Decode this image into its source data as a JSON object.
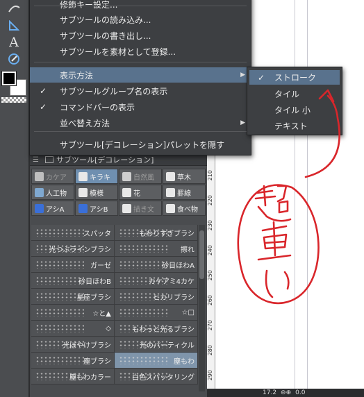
{
  "main_menu": {
    "items": [
      {
        "label": "修飾キー設定...",
        "checked": false,
        "submenu": false
      },
      {
        "label": "サブツールの読み込み...",
        "checked": false,
        "submenu": false
      },
      {
        "label": "サブツールの書き出し...",
        "checked": false,
        "submenu": false
      },
      {
        "label": "サブツールを素材として登録...",
        "checked": false,
        "submenu": false
      },
      {
        "label": "表示方法",
        "checked": false,
        "submenu": true,
        "highlighted": true
      },
      {
        "label": "サブツールグループ名の表示",
        "checked": true,
        "submenu": false
      },
      {
        "label": "コマンドバーの表示",
        "checked": true,
        "submenu": false
      },
      {
        "label": "並べ替え方法",
        "checked": false,
        "submenu": true
      },
      {
        "label": "サブツール[デコレーション]パレットを隠す",
        "checked": false,
        "submenu": false
      }
    ],
    "check_glyph": "✓",
    "arrow_glyph": "▶"
  },
  "display_submenu": {
    "items": [
      {
        "label": "ストローク",
        "checked": true
      },
      {
        "label": "タイル",
        "checked": false
      },
      {
        "label": "タイル 小",
        "checked": false
      },
      {
        "label": "テキスト",
        "checked": false
      }
    ]
  },
  "palette": {
    "title": "サブツール[デコレーション]",
    "groups": [
      {
        "label": "カケア",
        "icon": "shape-icon",
        "color": "#bfbfbf",
        "dim": true
      },
      {
        "label": "キラキ",
        "icon": "sparkle-icon",
        "color": "#e8e8e8",
        "selected": true
      },
      {
        "label": "自然風",
        "icon": "nature-icon",
        "color": "#cfcfcf",
        "dim": true
      },
      {
        "label": "草木",
        "icon": "grass-icon",
        "color": "#e8e8e8"
      },
      {
        "label": "人工物",
        "icon": "building-icon",
        "color": "#7fa8d0"
      },
      {
        "label": "模様",
        "icon": "pattern-icon",
        "color": "#e8e8e8"
      },
      {
        "label": "花",
        "icon": "flower-icon",
        "color": "#e8e8e8"
      },
      {
        "label": "罫線",
        "icon": "ruled-line-icon",
        "color": "#e8e8e8"
      },
      {
        "label": "アシA",
        "icon": "effect-line-icon",
        "color": "#3a6fd8"
      },
      {
        "label": "アシB",
        "icon": "effect-line-icon",
        "color": "#3a6fd8"
      },
      {
        "label": "描き文",
        "icon": "text-brush-icon",
        "color": "#e8e8e8",
        "dim": true
      },
      {
        "label": "食べ物",
        "icon": "food-icon",
        "color": "#e8e8e8"
      }
    ],
    "subtools": [
      [
        "スパッタ",
        "もわりすぎブラシ"
      ],
      [
        "光つぶラインブラシ",
        "擦れ"
      ],
      [
        "ガーゼ",
        "砂目ほわA"
      ],
      [
        "砂目ほわB",
        "カケアミ4カケ"
      ],
      [
        "星座ブラシ",
        "ヒカリブラシ"
      ],
      [
        "☆と▲",
        "☆□"
      ],
      [
        "◇",
        "もわっと光るブラシ"
      ],
      [
        "光ぼやけブラシ",
        "光のパーティクル"
      ],
      [
        "塵ブラシ",
        "塵もわ"
      ],
      [
        "塵もわカラー",
        "白色スパッタリング"
      ]
    ],
    "selected_subtool": "塵もわ"
  },
  "ruler": {
    "labels": [
      "210",
      "220",
      "230",
      "240",
      "250",
      "260",
      "270",
      "280",
      "290"
    ]
  },
  "bottom_bar": {
    "zoom": "17.2",
    "angle": "0.0"
  },
  "tools": {
    "text_tool_glyph": "A",
    "icons": [
      "brush-icon",
      "ruler-icon",
      "text-icon",
      "pen-icon"
    ]
  },
  "annotation": {
    "handwritten_text": "超重い",
    "color": "#d9262b"
  }
}
